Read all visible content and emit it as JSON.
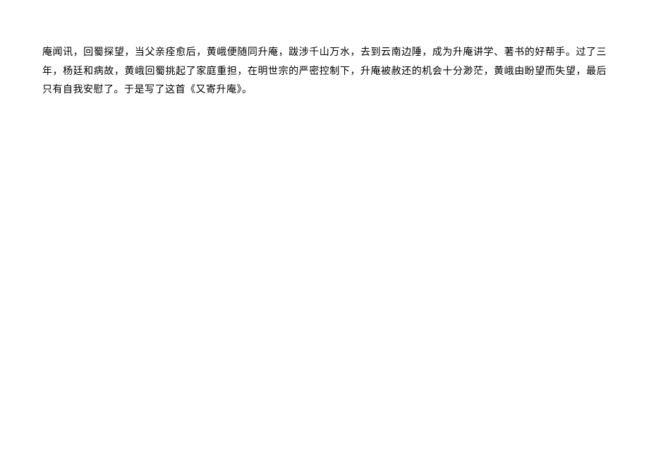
{
  "document": {
    "paragraph": "庵闻讯，回蜀探望，当父亲痊愈后，黄峨便随同升庵，跋涉千山万水，去到云南边陲，成为升庵讲学、著书的好帮手。过了三年，杨廷和病故，黄峨回蜀挑起了家庭重担，在明世宗的严密控制下，升庵被赦还的机会十分渺茫，黄峨由盼望而失望，最后只有自我安慰了。于是写了这首《又寄升庵》。"
  }
}
